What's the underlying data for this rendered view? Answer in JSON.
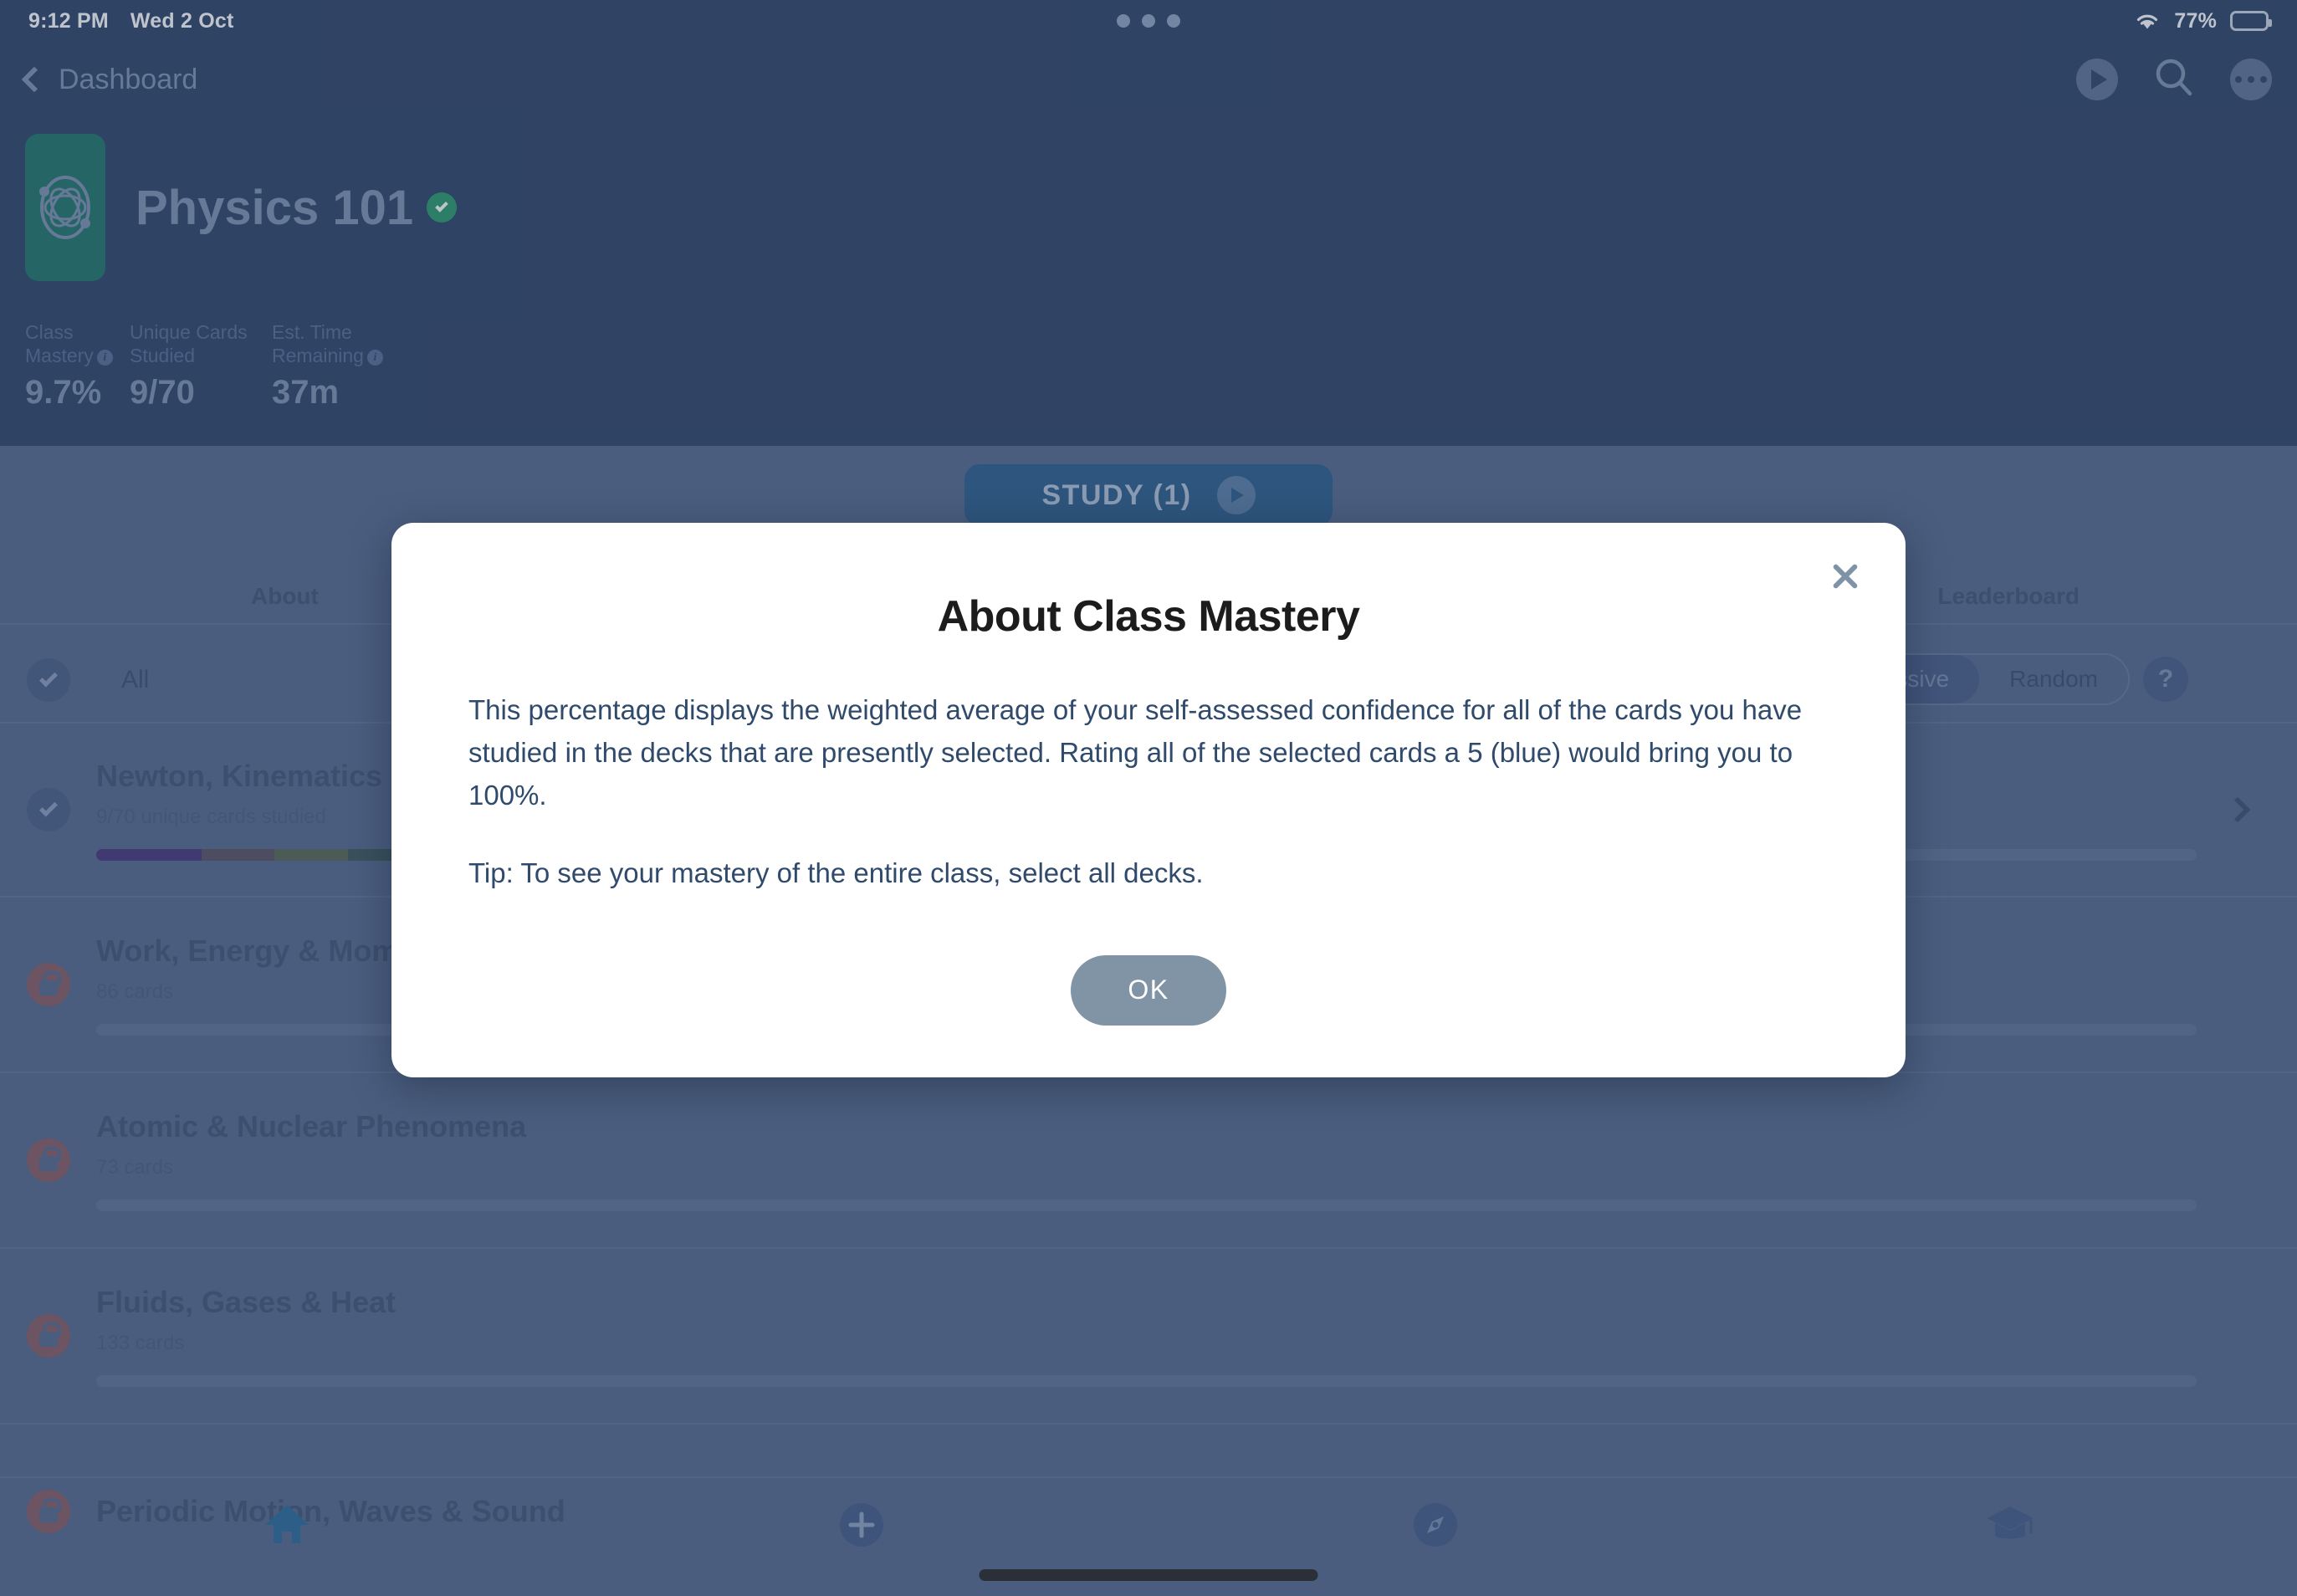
{
  "status_bar": {
    "time": "9:12 PM",
    "date": "Wed 2 Oct",
    "battery_percent": "77%",
    "wifi_icon": "wifi-icon",
    "battery_icon": "battery-icon",
    "multitask_dots": "more-dots-icon"
  },
  "nav": {
    "back_label": "Dashboard",
    "back_icon": "chevron-left-icon",
    "play_icon": "play-circle-icon",
    "search_icon": "search-icon",
    "more_icon": "more-horizontal-icon"
  },
  "class_header": {
    "icon": "atom-icon",
    "title": "Physics 101",
    "verified_icon": "verified-check-icon",
    "stats": [
      {
        "label": "Class Mastery",
        "value": "9.7%",
        "has_info": true,
        "info_icon": "info-icon"
      },
      {
        "label": "Unique Cards Studied",
        "value": "9/70",
        "has_info": false,
        "info_icon": ""
      },
      {
        "label": "Est. Time Remaining",
        "value": "37m",
        "has_info": true,
        "info_icon": "info-icon"
      }
    ]
  },
  "study": {
    "label": "STUDY (1)",
    "play_icon": "play-icon"
  },
  "tabs": {
    "about": "About",
    "leaderboard": "Leaderboard"
  },
  "filter": {
    "all_label": "All",
    "check_icon": "check-circle-icon",
    "segments": [
      {
        "label": "Progressive",
        "active": true
      },
      {
        "label": "Random",
        "active": false
      }
    ],
    "help_label": "?",
    "help_icon": "help-circle-icon"
  },
  "decks": [
    {
      "name": "Newton, Kinematics & Forces",
      "sub": "9/70 unique cards studied",
      "state": "selected",
      "state_icon": "check-circle-icon",
      "has_progress": true,
      "chevron_icon": "chevron-right-icon"
    },
    {
      "name": "Work, Energy & Momentum",
      "sub": "86 cards",
      "state": "locked",
      "state_icon": "lock-icon",
      "has_progress": false,
      "chevron_icon": ""
    },
    {
      "name": "Atomic & Nuclear Phenomena",
      "sub": "73 cards",
      "state": "locked",
      "state_icon": "lock-icon",
      "has_progress": false,
      "chevron_icon": ""
    },
    {
      "name": "Fluids, Gases & Heat",
      "sub": "133 cards",
      "state": "locked",
      "state_icon": "lock-icon",
      "has_progress": false,
      "chevron_icon": ""
    },
    {
      "name": "Periodic Motion, Waves & Sound",
      "sub": "",
      "state": "locked",
      "state_icon": "lock-icon",
      "has_progress": false,
      "chevron_icon": ""
    }
  ],
  "tabbar": [
    {
      "icon": "home-icon",
      "active": true
    },
    {
      "icon": "add-circle-icon",
      "active": false
    },
    {
      "icon": "compass-icon",
      "active": false
    },
    {
      "icon": "graduation-cap-icon",
      "active": false
    }
  ],
  "modal": {
    "title": "About Class Mastery",
    "close_icon": "close-icon",
    "paragraph_1": "This percentage displays the weighted average of your self-assessed confidence for all of the cards you have studied in the decks that are presently selected. Rating all of the selected cards a 5 (blue) would bring you to 100%.",
    "paragraph_2": "Tip: To see your mastery of the entire class, select all decks.",
    "ok_label": "OK"
  },
  "colors": {
    "header_navy": "#33486a",
    "body_slate": "#5a6e90",
    "accent_blue": "#31628f",
    "class_icon_teal": "#24796e",
    "verified_green": "#2f9e6e",
    "lock_red": "#8a6068",
    "ok_button": "#8194a6"
  }
}
